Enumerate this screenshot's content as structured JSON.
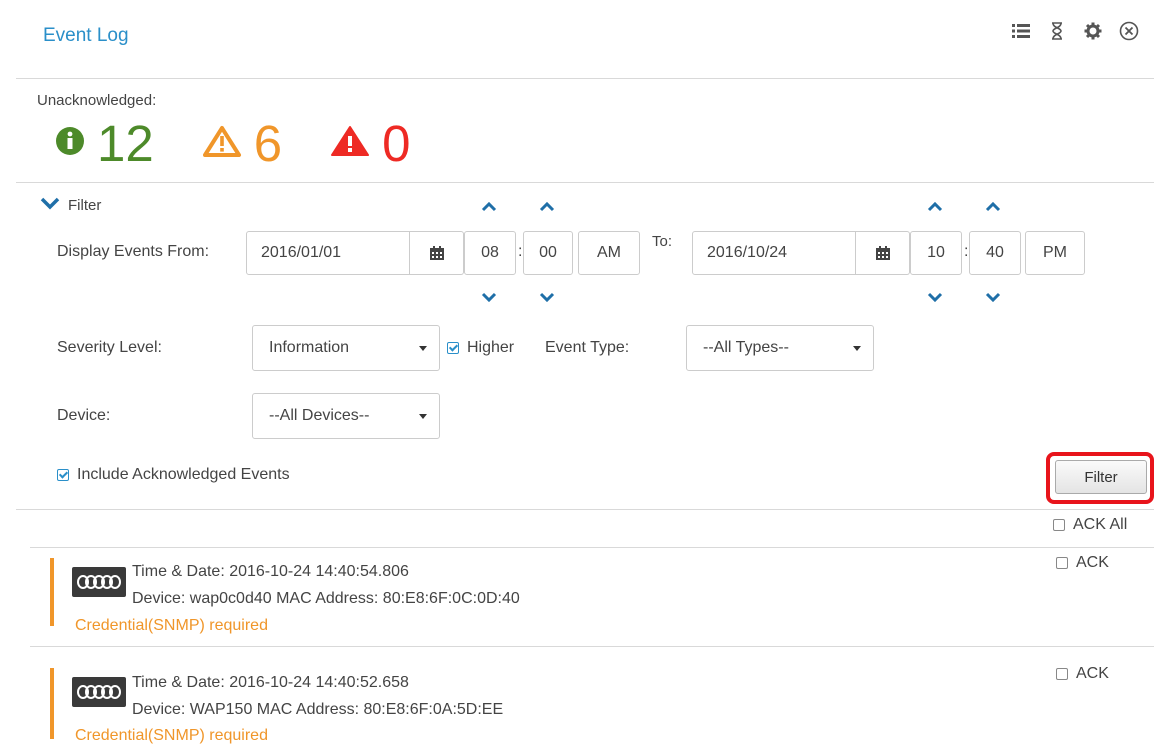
{
  "header": {
    "title": "Event Log",
    "icons": [
      "list-icon",
      "hourglass-icon",
      "gear-icon",
      "close-circle-icon"
    ]
  },
  "summary": {
    "label": "Unacknowledged:",
    "info_count": "12",
    "warning_count": "6",
    "error_count": "0",
    "colors": {
      "info": "#4d8a2a",
      "warning": "#f0962a",
      "error": "#ee2a24"
    }
  },
  "filter": {
    "toggle_label": "Filter",
    "from_label": "Display Events From:",
    "from_date": "2016/01/01",
    "from_hour": "08",
    "from_minute": "00",
    "from_ampm": "AM",
    "to_label": "To:",
    "to_date": "2016/10/24",
    "to_hour": "10",
    "to_minute": "40",
    "to_ampm": "PM",
    "severity_label": "Severity Level:",
    "severity_value": "Information",
    "higher_label": "Higher",
    "event_type_label": "Event Type:",
    "event_type_value": "--All Types--",
    "device_label": "Device:",
    "device_value": "--All Devices--",
    "include_ack_label": "Include Acknowledged Events",
    "button_label": "Filter"
  },
  "list": {
    "ack_all_label": "ACK All",
    "events": [
      {
        "time": "Time & Date:  2016-10-24 14:40:54.806",
        "device": "Device: wap0c0d40  MAC Address: 80:E8:6F:0C:0D:40",
        "message": "Credential(SNMP) required",
        "ack_label": "ACK"
      },
      {
        "time": "Time & Date:  2016-10-24 14:40:52.658",
        "device": "Device: WAP150  MAC Address: 80:E8:6F:0A:5D:EE",
        "message": "Credential(SNMP) required",
        "ack_label": "ACK"
      }
    ]
  }
}
